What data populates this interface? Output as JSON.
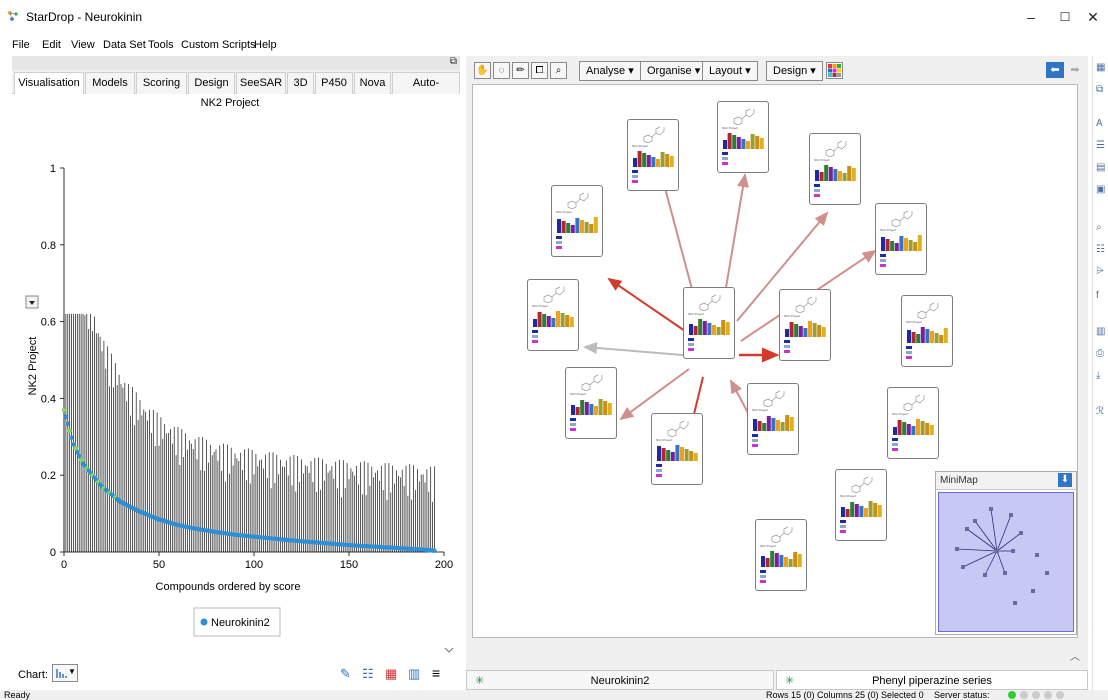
{
  "window": {
    "title": "StarDrop - Neurokinin",
    "controls": [
      "–",
      "☐",
      "✕"
    ]
  },
  "menu": [
    "File",
    "Edit",
    "View",
    "Data Set",
    "Tools",
    "Custom Scripts",
    "Help"
  ],
  "left_panel": {
    "tabs": [
      "Visualisation",
      "Models",
      "Scoring",
      "Design",
      "SeeSAR",
      "3D",
      "P450",
      "Nova",
      "Auto-Modeller"
    ],
    "active_tab": "Visualisation",
    "chart_label": "Chart:",
    "bottom_icons": [
      "edit-icon",
      "checklist-icon",
      "grid-icon",
      "add-chart-icon",
      "menu-icon"
    ]
  },
  "chart_data": {
    "type": "scatter",
    "title": "NK2 Project",
    "xlabel": "Compounds ordered by score",
    "ylabel": "NK2 Project",
    "xlim": [
      0,
      200
    ],
    "ylim": [
      0,
      1
    ],
    "x_ticks": [
      "0",
      "50",
      "100",
      "150",
      "200"
    ],
    "y_ticks": [
      "0",
      "0.2",
      "0.4",
      "0.6",
      "0.8",
      "1"
    ],
    "error_bars": true,
    "series": [
      {
        "name": "Neurokinin2",
        "color": "#2f8fd6",
        "x": [
          0,
          5,
          10,
          15,
          20,
          25,
          30,
          40,
          50,
          60,
          70,
          80,
          90,
          100,
          110,
          120,
          130,
          140,
          150,
          160,
          170,
          180,
          190,
          195
        ],
        "y": [
          0.37,
          0.28,
          0.23,
          0.2,
          0.17,
          0.15,
          0.13,
          0.105,
          0.085,
          0.07,
          0.06,
          0.052,
          0.045,
          0.04,
          0.035,
          0.03,
          0.026,
          0.022,
          0.018,
          0.015,
          0.012,
          0.009,
          0.006,
          0.003
        ]
      }
    ],
    "legend_position": "bottom-center"
  },
  "right_panel": {
    "toolbar": {
      "dropdowns": [
        "Analyse",
        "Organise",
        "Layout",
        "Design"
      ],
      "icons": [
        "hand-icon",
        "lasso-icon",
        "pencil-icon",
        "node-select-icon",
        "zoom-icon"
      ]
    },
    "node_label": "NK2 Project",
    "minimap_title": "MiniMap",
    "doc_tabs": [
      "Neurokinin2",
      "Phenyl piperazine series"
    ],
    "active_doc_tab": "Phenyl piperazine series"
  },
  "status": {
    "left": "Ready",
    "counts": "Rows 15 (0) Columns 25 (0) Selected 0",
    "server": "Server status:"
  }
}
